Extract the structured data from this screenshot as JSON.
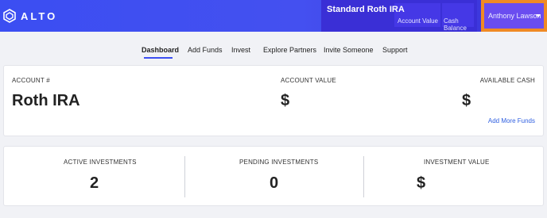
{
  "header": {
    "logo_text": "ALTO",
    "account_title": "Standard Roth IRA",
    "account_value_label": "Account Value",
    "cash_balance_label": "Cash Balance",
    "user_name": "Anthony Lawson"
  },
  "nav": {
    "items": [
      "Dashboard",
      "Add Funds",
      "Invest",
      "Explore Partners",
      "Invite Someone",
      "Support"
    ],
    "active": "Dashboard"
  },
  "summary": {
    "account_label": "ACCOUNT #",
    "account_name": "Roth IRA",
    "account_value_label": "ACCOUNT VALUE",
    "account_value": "$",
    "available_cash_label": "AVAILABLE CASH",
    "available_cash": "$",
    "add_funds_link": "Add More Funds"
  },
  "investments": {
    "active_label": "ACTIVE INVESTMENTS",
    "active_value": "2",
    "pending_label": "PENDING INVESTMENTS",
    "pending_value": "0",
    "value_label": "INVESTMENT VALUE",
    "value_amount": "$"
  },
  "colors": {
    "brand_blue": "#3b4ef2",
    "account_panel": "#3a2fd6",
    "highlight_orange": "#f08a24",
    "link": "#2f5fe0"
  }
}
